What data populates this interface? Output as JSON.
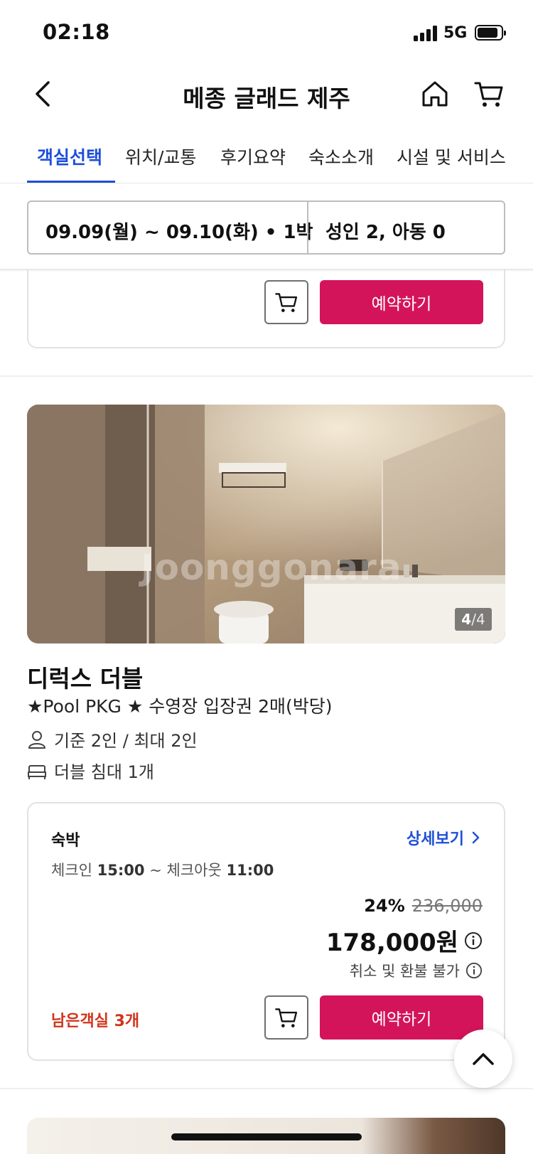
{
  "status_bar": {
    "time": "02:18",
    "network": "5G"
  },
  "header": {
    "title": "메종 글래드 제주"
  },
  "tabs": [
    {
      "label": "객실선택",
      "active": true
    },
    {
      "label": "위치/교통",
      "active": false
    },
    {
      "label": "후기요약",
      "active": false
    },
    {
      "label": "숙소소개",
      "active": false
    },
    {
      "label": "시설 및 서비스",
      "active": false
    }
  ],
  "search": {
    "date_range": "09.09(월) ~ 09.10(화) • 1박",
    "guests": "성인 2, 아동 0"
  },
  "prev_card": {
    "book_label": "예약하기"
  },
  "room": {
    "image_counter": {
      "current": "4",
      "total": "/4"
    },
    "watermark": "Joonggonara",
    "name": "디럭스 더블",
    "subtitle": "★Pool PKG ★ 수영장 입장권 2매(박당)",
    "capacity": "기준 2인 / 최대 2인",
    "bed": "더블 침대 1개"
  },
  "rate": {
    "type": "숙박",
    "detail_link": "상세보기",
    "checkin_label": "체크인",
    "checkin_time": "15:00",
    "checkin_sep": "~",
    "checkout_label": "체크아웃",
    "checkout_time": "11:00",
    "discount": "24%",
    "original_price": "236,000",
    "final_price": "178,000원",
    "refund_policy": "취소 및 환불 불가",
    "rooms_left": "남은객실 3개",
    "book_label": "예약하기"
  },
  "colors": {
    "accent_blue": "#1f4fd8",
    "book_pink": "#d4145a",
    "alert_red": "#d0351b"
  }
}
